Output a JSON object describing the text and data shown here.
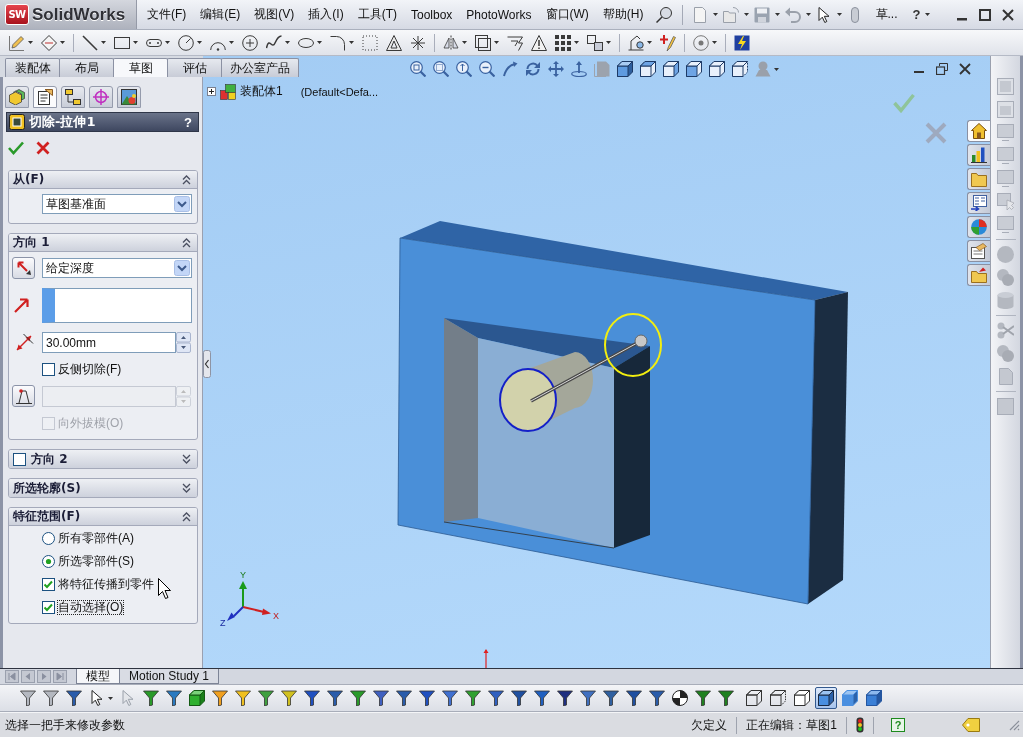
{
  "menu_bar": {
    "logo_badge": "SW",
    "logo_text": "SolidWorks",
    "menus": [
      "文件(F)",
      "编辑(E)",
      "视图(V)",
      "插入(I)",
      "工具(T)",
      "Toolbox",
      "PhotoWorks",
      "窗口(W)",
      "帮助(H)"
    ],
    "document_label": "草...",
    "help": "?"
  },
  "command_tabs": [
    {
      "label": "装配体",
      "selected": false
    },
    {
      "label": "布局",
      "selected": false
    },
    {
      "label": "草图",
      "selected": true
    },
    {
      "label": "评估",
      "selected": false
    },
    {
      "label": "办公室产品",
      "selected": false
    }
  ],
  "property_manager": {
    "tabs": [
      {
        "selected": false
      },
      {
        "selected": true
      },
      {
        "selected": false
      },
      {
        "selected": false
      },
      {
        "selected": false
      }
    ],
    "title": "切除-拉伸1",
    "help": "?",
    "groups": [
      {
        "title": "从(F)",
        "expanded": true,
        "rows": [
          {
            "kind": "select",
            "value": "草图基准面"
          }
        ]
      },
      {
        "title": "方向 1",
        "expanded": true,
        "rows": [
          {
            "kind": "flip-select",
            "value": "给定深度"
          },
          {
            "kind": "selection-list"
          },
          {
            "kind": "depth",
            "value": "30.00mm",
            "disabled": false
          },
          {
            "kind": "checkbox",
            "label": "反侧切除(F)",
            "checked": false,
            "disabled": false,
            "focused": false
          },
          {
            "kind": "draft",
            "disabled": true
          },
          {
            "kind": "checkbox",
            "label": "向外拔模(O)",
            "checked": false,
            "disabled": true,
            "focused": false
          }
        ]
      },
      {
        "title": "方向 2",
        "expanded": false,
        "checked": false
      },
      {
        "title": "所选轮廓(S)",
        "expanded": false
      },
      {
        "title": "特征范围(F)",
        "expanded": true,
        "rows": [
          {
            "kind": "radio",
            "label": "所有零部件(A)",
            "selected": false
          },
          {
            "kind": "radio",
            "label": "所选零部件(S)",
            "selected": true
          },
          {
            "kind": "checkbox",
            "label": "将特征传播到零件",
            "checked": true,
            "disabled": false,
            "focused": false
          },
          {
            "kind": "checkbox",
            "label": "自动选择(O)",
            "checked": true,
            "disabled": false,
            "focused": true
          }
        ]
      }
    ]
  },
  "viewport": {
    "tree_root": {
      "expanded": false,
      "label": "装配体1",
      "configuration": "(Default<Defa..."
    },
    "triad": {
      "y": "Y",
      "x": "X",
      "z": "Z"
    }
  },
  "task_pane_tabs": [
    {
      "selected": true
    },
    {
      "selected": false
    },
    {
      "selected": false
    },
    {
      "selected": false
    },
    {
      "selected": false
    },
    {
      "selected": false
    },
    {
      "selected": false
    }
  ],
  "bottom_tabs": [
    {
      "label": "模型",
      "selected": true
    },
    {
      "label": "Motion Study 1",
      "selected": false
    }
  ],
  "display_style_buttons": [
    {
      "selected": false
    },
    {
      "selected": false
    },
    {
      "selected": false
    },
    {
      "selected": true
    },
    {
      "selected": false
    },
    {
      "selected": false
    }
  ],
  "status_bar": {
    "message": "选择一把手来修改参数",
    "sketch_status": "欠定义",
    "editing": "正在编辑：草图1",
    "help": "?"
  }
}
